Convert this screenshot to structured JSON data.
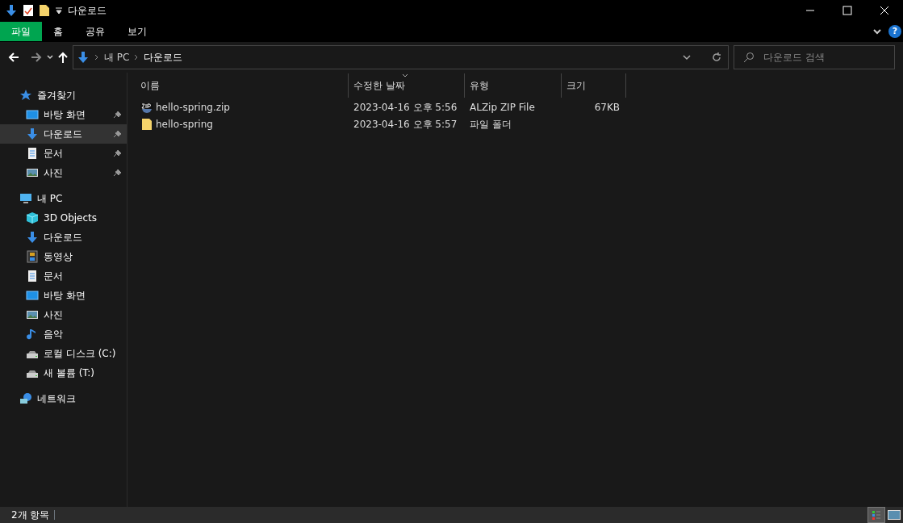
{
  "window": {
    "title": "다운로드"
  },
  "ribbon_tabs": [
    {
      "label": "파일",
      "selected": true
    },
    {
      "label": "홈",
      "selected": false
    },
    {
      "label": "공유",
      "selected": false
    },
    {
      "label": "보기",
      "selected": false
    }
  ],
  "help": {
    "label": "?"
  },
  "address": {
    "crumbs": [
      "내 PC",
      "다운로드"
    ]
  },
  "search": {
    "placeholder": "다운로드 검색"
  },
  "sidebar": {
    "items": [
      {
        "label": "즐겨찾기",
        "kind": "star",
        "selected": false,
        "children": [
          {
            "label": "바탕 화면",
            "kind": "desktop",
            "selected": false,
            "pinned": true
          },
          {
            "label": "다운로드",
            "kind": "download",
            "selected": true,
            "pinned": true
          },
          {
            "label": "문서",
            "kind": "document",
            "selected": false,
            "pinned": true
          },
          {
            "label": "사진",
            "kind": "picture",
            "selected": false,
            "pinned": true
          }
        ]
      },
      {
        "label": "내 PC",
        "kind": "pc",
        "selected": false,
        "children": [
          {
            "label": "3D Objects",
            "kind": "cube",
            "selected": false,
            "pinned": false
          },
          {
            "label": "다운로드",
            "kind": "download",
            "selected": false,
            "pinned": false
          },
          {
            "label": "동영상",
            "kind": "video",
            "selected": false,
            "pinned": false
          },
          {
            "label": "문서",
            "kind": "document",
            "selected": false,
            "pinned": false
          },
          {
            "label": "바탕 화면",
            "kind": "desktop",
            "selected": false,
            "pinned": false
          },
          {
            "label": "사진",
            "kind": "picture",
            "selected": false,
            "pinned": false
          },
          {
            "label": "음악",
            "kind": "music",
            "selected": false,
            "pinned": false
          },
          {
            "label": "로컬 디스크 (C:)",
            "kind": "drive",
            "selected": false,
            "pinned": false
          },
          {
            "label": "새 볼륨 (T:)",
            "kind": "drive",
            "selected": false,
            "pinned": false
          }
        ]
      },
      {
        "label": "네트워크",
        "kind": "network",
        "selected": false
      }
    ]
  },
  "table": {
    "columns": [
      {
        "label": "이름",
        "sorted": false
      },
      {
        "label": "수정한 날짜",
        "sorted": true
      },
      {
        "label": "유형",
        "sorted": false
      },
      {
        "label": "크기",
        "sorted": false
      }
    ],
    "rows": [
      {
        "kind": "zip",
        "name": "hello-spring.zip",
        "modified": "2023-04-16 오후 5:56",
        "type": "ALZip ZIP File",
        "size": "67KB"
      },
      {
        "kind": "folder",
        "name": "hello-spring",
        "modified": "2023-04-16 오후 5:57",
        "type": "파일 폴더",
        "size": ""
      }
    ]
  },
  "status_bar": {
    "text": "2개 항목",
    "views": [
      {
        "kind": "details",
        "selected": true
      },
      {
        "kind": "large",
        "selected": false
      }
    ]
  }
}
